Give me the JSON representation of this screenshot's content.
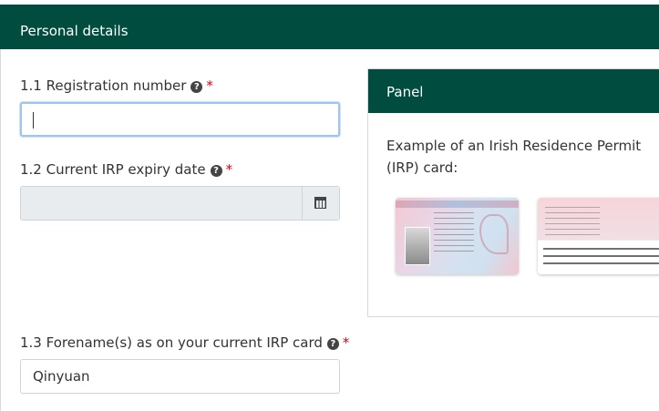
{
  "header": {
    "title": "Personal details"
  },
  "fields": {
    "registration": {
      "label": "1.1 Registration number",
      "value": "",
      "required_mark": "*"
    },
    "expiry": {
      "label": "1.2 Current IRP expiry date",
      "value": "",
      "required_mark": "*"
    },
    "forename": {
      "label": "1.3 Forename(s) as on your current IRP card",
      "value": "Qinyuan",
      "required_mark": "*"
    }
  },
  "help_icon_text": "?",
  "panel": {
    "title": "Panel",
    "text": "Example of an Irish Residence Permit (IRP) card:"
  },
  "icons": {
    "help": "question-circle-icon",
    "calendar": "calendar-icon"
  },
  "colors": {
    "header": "#004d40",
    "required": "#d0021b",
    "focus_border": "#9ec5ee"
  }
}
